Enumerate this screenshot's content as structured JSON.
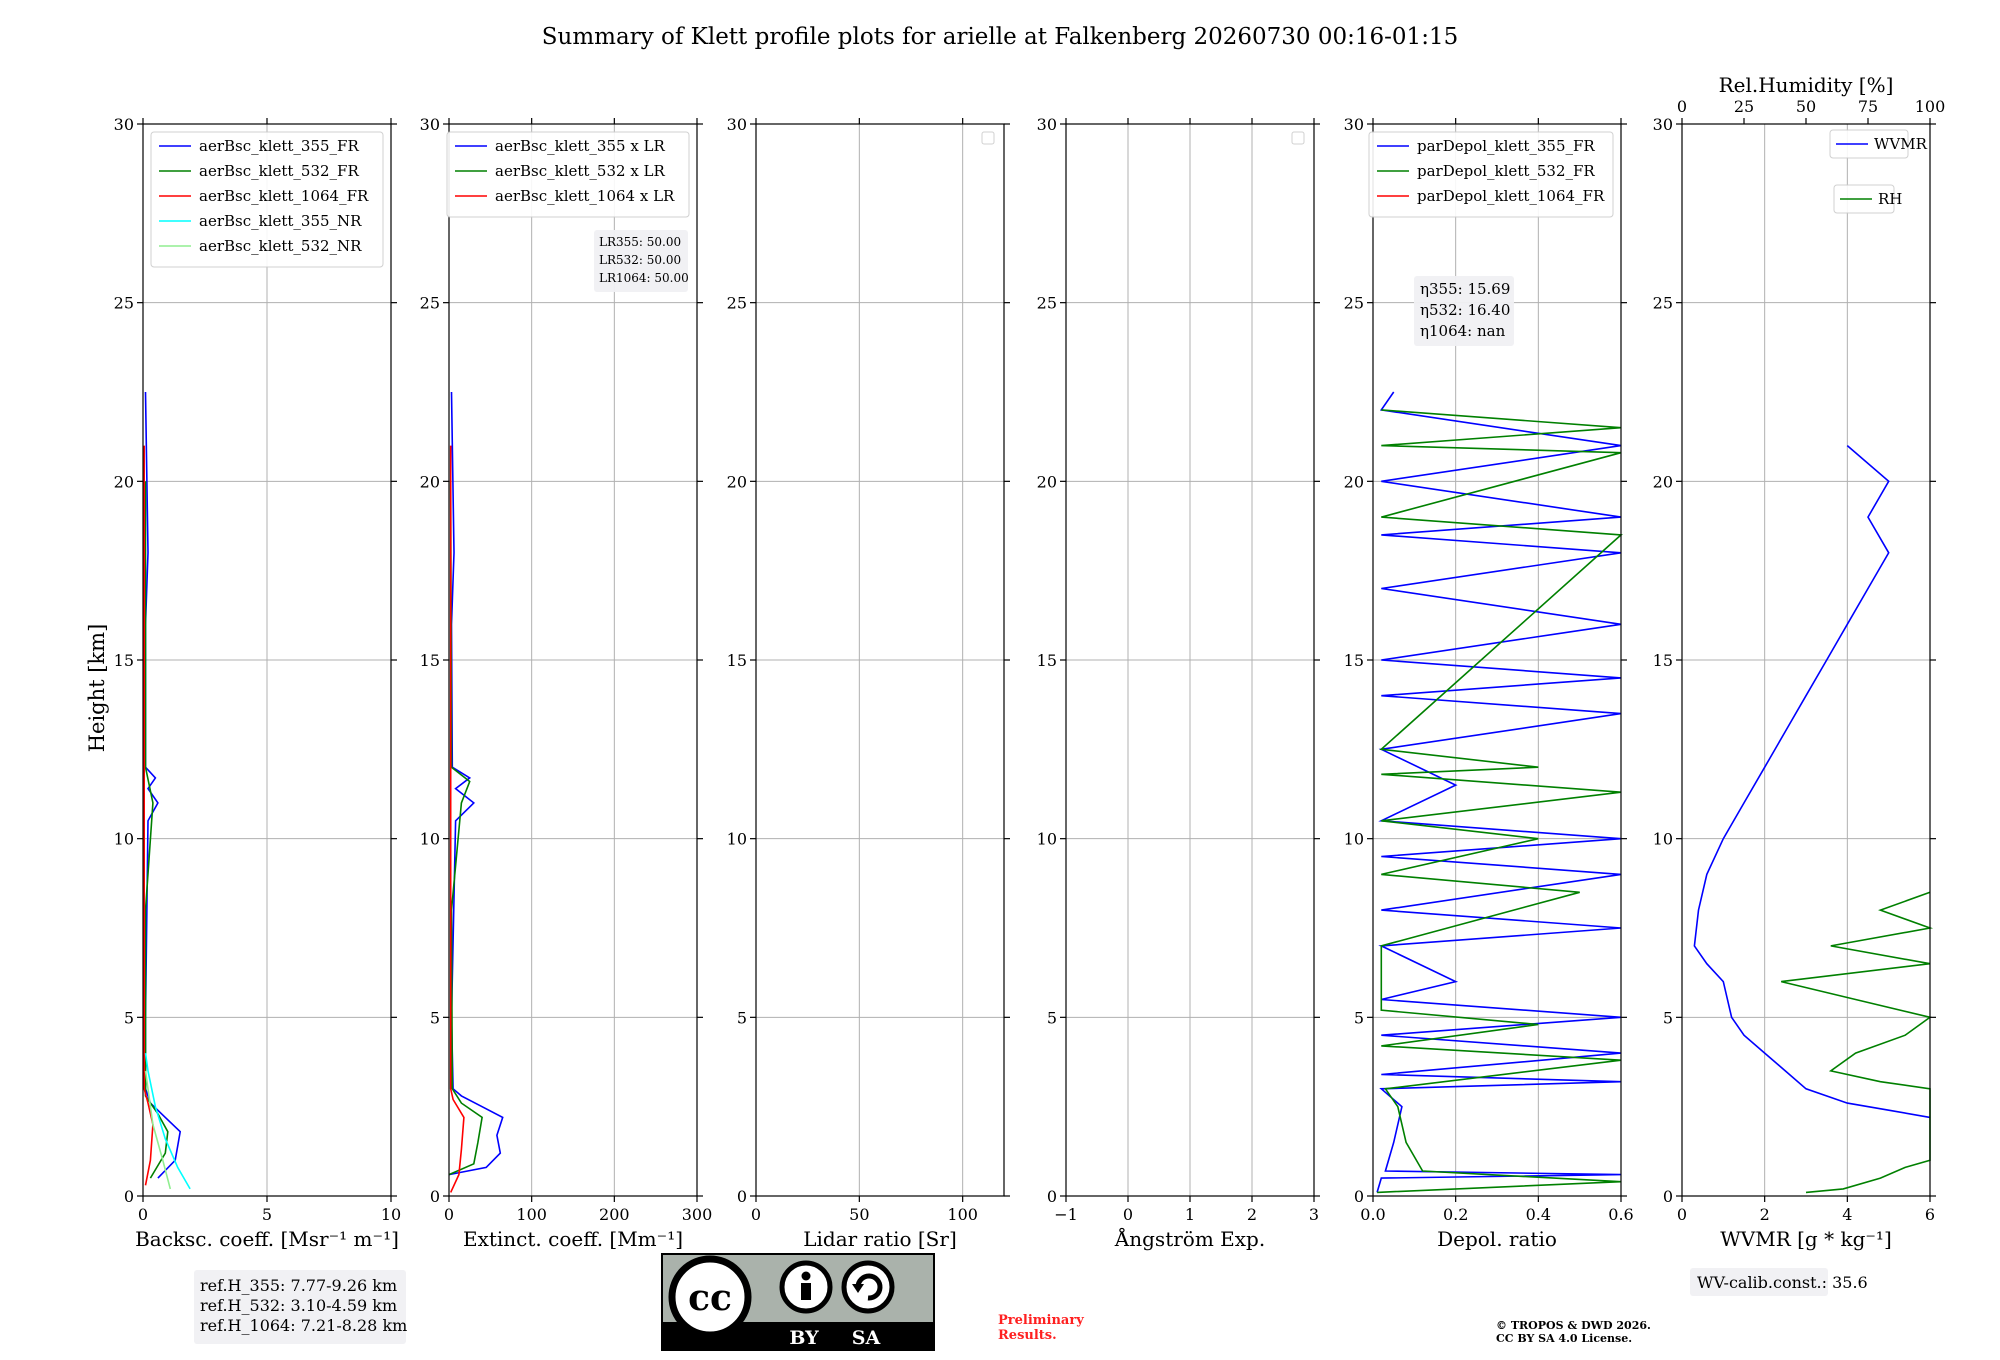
{
  "figure_title": "Summary of Klett profile plots for arielle at Falkenberg 20260730 00:16-01:15",
  "shared_ylabel": "Height [km]",
  "reference_box": [
    "ref.H_355: 7.77-9.26 km",
    "ref.H_532: 3.10-4.59 km",
    "ref.H_1064: 7.21-8.28 km"
  ],
  "lidar_ratio_box": [
    "LR355: 50.00",
    "LR532: 50.00",
    "LR1064: 50.00"
  ],
  "eta_box": [
    "η355: 15.69",
    "η532: 16.40",
    "η1064: nan"
  ],
  "wv_calib": "WV-calib.const.: 35.6",
  "license_badge": {
    "cc": "cc",
    "by": "BY",
    "sa": "SA"
  },
  "preliminary_note": [
    "Preliminary",
    "Results."
  ],
  "copyright_note": [
    "© TROPOS & DWD 2026.",
    "CC BY SA 4.0 License."
  ],
  "colors": {
    "blue": "#0000ff",
    "green": "#008000",
    "red": "#ff0000",
    "cyan": "#00ffff",
    "lightgreen": "#90ee90"
  },
  "chart_data": [
    {
      "type": "line",
      "xlabel": "Backsc. coeff. [Msr⁻¹ m⁻¹]",
      "xlim": [
        0,
        10
      ],
      "xticks": [
        "0",
        "5",
        "10"
      ],
      "xtick_values": [
        0,
        5,
        10
      ],
      "ylim": [
        0,
        30
      ],
      "yticks": [
        "0",
        "5",
        "10",
        "15",
        "20",
        "25",
        "30"
      ],
      "grid": true,
      "legend_position": "top-right",
      "series": [
        {
          "name": "aerBsc_klett_355_FR",
          "color": "#0000ff",
          "points": [
            [
              0.6,
              0.5
            ],
            [
              1.3,
              1.0
            ],
            [
              1.5,
              1.8
            ],
            [
              0.9,
              2.2
            ],
            [
              0.3,
              2.6
            ],
            [
              0.1,
              3.0
            ],
            [
              0.1,
              5.0
            ],
            [
              0.2,
              10.5
            ],
            [
              0.6,
              11.0
            ],
            [
              0.2,
              11.4
            ],
            [
              0.5,
              11.7
            ],
            [
              0.1,
              12.0
            ],
            [
              0.1,
              16.0
            ],
            [
              0.2,
              18.0
            ],
            [
              0.1,
              22.5
            ]
          ]
        },
        {
          "name": "aerBsc_klett_532_FR",
          "color": "#008000",
          "points": [
            [
              0.3,
              0.5
            ],
            [
              0.9,
              1.2
            ],
            [
              1.0,
              1.8
            ],
            [
              0.6,
              2.3
            ],
            [
              0.1,
              2.8
            ],
            [
              0.1,
              8.0
            ],
            [
              0.4,
              11.0
            ],
            [
              0.1,
              12.0
            ],
            [
              0.1,
              20.0
            ]
          ]
        },
        {
          "name": "aerBsc_klett_1064_FR",
          "color": "#ff0000",
          "points": [
            [
              0.1,
              0.3
            ],
            [
              0.3,
              1.0
            ],
            [
              0.4,
              2.0
            ],
            [
              0.2,
              2.6
            ],
            [
              0.05,
              3.0
            ],
            [
              0.05,
              12.0
            ],
            [
              0.05,
              21.0
            ]
          ]
        },
        {
          "name": "aerBsc_klett_355_NR",
          "color": "#00ffff",
          "points": [
            [
              1.9,
              0.2
            ],
            [
              1.4,
              0.8
            ],
            [
              0.9,
              1.6
            ],
            [
              0.5,
              2.5
            ],
            [
              0.2,
              3.5
            ],
            [
              0.1,
              4.0
            ]
          ]
        },
        {
          "name": "aerBsc_klett_532_NR",
          "color": "#90ee90",
          "points": [
            [
              1.1,
              0.2
            ],
            [
              0.8,
              1.0
            ],
            [
              0.4,
              2.0
            ],
            [
              0.1,
              3.5
            ]
          ]
        }
      ]
    },
    {
      "type": "line",
      "xlabel": "Extinct. coeff. [Mm⁻¹]",
      "xlim": [
        0,
        300
      ],
      "xticks": [
        "0",
        "100",
        "200",
        "300"
      ],
      "xtick_values": [
        0,
        100,
        200,
        300
      ],
      "ylim": [
        0,
        30
      ],
      "yticks": [
        "0",
        "5",
        "10",
        "15",
        "20",
        "25",
        "30"
      ],
      "grid": true,
      "legend_position": "top-right",
      "series": [
        {
          "name": "aerBsc_klett_355 x LR",
          "color": "#0000ff",
          "points": [
            [
              0,
              0.6
            ],
            [
              45,
              0.8
            ],
            [
              62,
              1.2
            ],
            [
              58,
              1.7
            ],
            [
              65,
              2.2
            ],
            [
              40,
              2.5
            ],
            [
              15,
              2.8
            ],
            [
              5,
              3.0
            ],
            [
              3,
              5.0
            ],
            [
              8,
              10.5
            ],
            [
              30,
              11.0
            ],
            [
              8,
              11.4
            ],
            [
              25,
              11.7
            ],
            [
              4,
              12.0
            ],
            [
              3,
              16.0
            ],
            [
              6,
              18.0
            ],
            [
              3,
              22.5
            ]
          ]
        },
        {
          "name": "aerBsc_klett_532 x LR",
          "color": "#008000",
          "points": [
            [
              0,
              0.6
            ],
            [
              30,
              0.9
            ],
            [
              35,
              1.5
            ],
            [
              40,
              2.2
            ],
            [
              15,
              2.6
            ],
            [
              4,
              3.0
            ],
            [
              3,
              8.0
            ],
            [
              15,
              11.0
            ],
            [
              25,
              11.6
            ],
            [
              3,
              12.0
            ],
            [
              2,
              20.0
            ]
          ]
        },
        {
          "name": "aerBsc_klett_1064 x LR",
          "color": "#ff0000",
          "points": [
            [
              2,
              0.1
            ],
            [
              12,
              0.6
            ],
            [
              15,
              1.3
            ],
            [
              18,
              2.2
            ],
            [
              5,
              2.7
            ],
            [
              2,
              3.0
            ],
            [
              2,
              12.0
            ],
            [
              2,
              21.0
            ]
          ]
        }
      ]
    },
    {
      "type": "line",
      "xlabel": "Lidar ratio [Sr]",
      "xlim": [
        0,
        120
      ],
      "xticks": [
        "0",
        "50",
        "100"
      ],
      "xtick_values": [
        0,
        50,
        100
      ],
      "ylim": [
        0,
        30
      ],
      "yticks": [
        "0",
        "5",
        "10",
        "15",
        "20",
        "25",
        "30"
      ],
      "grid": true,
      "legend_position": "top-right",
      "series": []
    },
    {
      "type": "line",
      "xlabel": "Ångström Exp.",
      "xlim": [
        -1,
        3
      ],
      "xticks": [
        "−1",
        "0",
        "1",
        "2",
        "3"
      ],
      "xtick_values": [
        -1,
        0,
        1,
        2,
        3
      ],
      "ylim": [
        0,
        30
      ],
      "yticks": [
        "0",
        "5",
        "10",
        "15",
        "20",
        "25",
        "30"
      ],
      "grid": true,
      "legend_position": "top-right",
      "series": []
    },
    {
      "type": "line",
      "xlabel": "Depol. ratio",
      "xlim": [
        0,
        0.6
      ],
      "xticks": [
        "0.0",
        "0.2",
        "0.4",
        "0.6"
      ],
      "xtick_values": [
        0,
        0.2,
        0.4,
        0.6
      ],
      "ylim": [
        0,
        30
      ],
      "yticks": [
        "0",
        "5",
        "10",
        "15",
        "20",
        "25",
        "30"
      ],
      "grid": true,
      "legend_position": "top-right",
      "series": [
        {
          "name": "parDepol_klett_355_FR",
          "color": "#0000ff",
          "points": [
            [
              0.01,
              0.1
            ],
            [
              0.02,
              0.5
            ],
            [
              0.6,
              0.6
            ],
            [
              0.03,
              0.7
            ],
            [
              0.05,
              1.5
            ],
            [
              0.07,
              2.5
            ],
            [
              0.02,
              3.0
            ],
            [
              0.6,
              3.2
            ],
            [
              0.02,
              3.4
            ],
            [
              0.6,
              4.0
            ],
            [
              0.02,
              4.5
            ],
            [
              0.6,
              5.0
            ],
            [
              0.02,
              5.5
            ],
            [
              0.2,
              6.0
            ],
            [
              0.02,
              7.0
            ],
            [
              0.6,
              7.5
            ],
            [
              0.02,
              8.0
            ],
            [
              0.6,
              9.0
            ],
            [
              0.02,
              9.5
            ],
            [
              0.6,
              10.0
            ],
            [
              0.02,
              10.5
            ],
            [
              0.2,
              11.5
            ],
            [
              0.02,
              12.5
            ],
            [
              0.6,
              13.5
            ],
            [
              0.02,
              14.0
            ],
            [
              0.6,
              14.5
            ],
            [
              0.02,
              15.0
            ],
            [
              0.6,
              16.0
            ],
            [
              0.02,
              17.0
            ],
            [
              0.6,
              18.0
            ],
            [
              0.02,
              18.5
            ],
            [
              0.6,
              19.0
            ],
            [
              0.02,
              20.0
            ],
            [
              0.6,
              21.0
            ],
            [
              0.02,
              22.0
            ],
            [
              0.05,
              22.5
            ]
          ]
        },
        {
          "name": "parDepol_klett_532_FR",
          "color": "#008000",
          "points": [
            [
              0.01,
              0.1
            ],
            [
              0.6,
              0.4
            ],
            [
              0.12,
              0.7
            ],
            [
              0.08,
              1.5
            ],
            [
              0.06,
              2.5
            ],
            [
              0.03,
              3.0
            ],
            [
              0.6,
              3.8
            ],
            [
              0.02,
              4.2
            ],
            [
              0.4,
              4.8
            ],
            [
              0.02,
              5.2
            ],
            [
              0.02,
              7.0
            ],
            [
              0.5,
              8.5
            ],
            [
              0.02,
              9.0
            ],
            [
              0.4,
              10.0
            ],
            [
              0.02,
              10.5
            ],
            [
              0.6,
              11.3
            ],
            [
              0.02,
              11.8
            ],
            [
              0.4,
              12.0
            ],
            [
              0.02,
              12.5
            ],
            [
              0.6,
              18.5
            ],
            [
              0.02,
              19.0
            ],
            [
              0.6,
              20.8
            ],
            [
              0.02,
              21.0
            ],
            [
              0.6,
              21.5
            ],
            [
              0.02,
              22.0
            ]
          ]
        },
        {
          "name": "parDepol_klett_1064_FR",
          "color": "#ff0000",
          "points": []
        }
      ]
    },
    {
      "type": "line",
      "xlabel": "WVMR [g * kg⁻¹]",
      "xlim": [
        0,
        6
      ],
      "xticks": [
        "0",
        "2",
        "4",
        "6"
      ],
      "xtick_values": [
        0,
        2,
        4,
        6
      ],
      "ylim": [
        0,
        30
      ],
      "yticks": [
        "0",
        "5",
        "10",
        "15",
        "20",
        "25",
        "30"
      ],
      "top_axis_label": "Rel.Humidity [%]",
      "top_xlim": [
        0,
        100
      ],
      "top_xticks": [
        "0",
        "25",
        "50",
        "75",
        "100"
      ],
      "top_xtick_values": [
        0,
        25,
        50,
        75,
        100
      ],
      "grid": true,
      "legend_position": "top-right",
      "series": [
        {
          "name": "WVMR",
          "color": "#0000ff",
          "axis": "bottom",
          "points": [
            [
              6.0,
              2.2
            ],
            [
              5.0,
              2.4
            ],
            [
              4.0,
              2.6
            ],
            [
              3.0,
              3.0
            ],
            [
              2.5,
              3.5
            ],
            [
              2.0,
              4.0
            ],
            [
              1.5,
              4.5
            ],
            [
              1.2,
              5.0
            ],
            [
              1.0,
              6.0
            ],
            [
              0.6,
              6.5
            ],
            [
              0.3,
              7.0
            ],
            [
              0.4,
              8.0
            ],
            [
              0.6,
              9.0
            ],
            [
              1.0,
              10.0
            ],
            [
              1.5,
              11.0
            ],
            [
              2.0,
              12.0
            ],
            [
              2.5,
              13.0
            ],
            [
              3.0,
              14.0
            ],
            [
              3.5,
              15.0
            ],
            [
              4.0,
              16.0
            ],
            [
              4.5,
              17.0
            ],
            [
              5.0,
              18.0
            ],
            [
              4.5,
              19.0
            ],
            [
              5.0,
              20.0
            ],
            [
              4.0,
              21.0
            ]
          ]
        },
        {
          "name": "RH",
          "color": "#008000",
          "axis": "top",
          "points": [
            [
              50,
              0.1
            ],
            [
              65,
              0.2
            ],
            [
              80,
              0.5
            ],
            [
              90,
              0.8
            ],
            [
              100,
              1.0
            ],
            [
              100,
              3.0
            ],
            [
              80,
              3.2
            ],
            [
              60,
              3.5
            ],
            [
              70,
              4.0
            ],
            [
              90,
              4.5
            ],
            [
              100,
              5.0
            ],
            [
              70,
              5.5
            ],
            [
              40,
              6.0
            ],
            [
              100,
              6.5
            ],
            [
              60,
              7.0
            ],
            [
              100,
              7.5
            ],
            [
              80,
              8.0
            ],
            [
              100,
              8.5
            ]
          ]
        }
      ]
    }
  ]
}
